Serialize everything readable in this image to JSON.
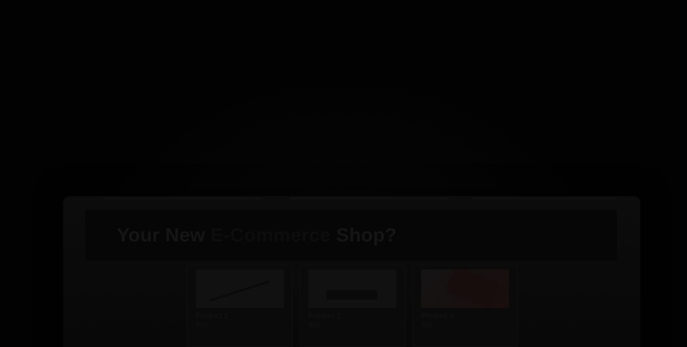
{
  "hero": {
    "headline_pre": "Your New",
    "headline_accent": "E-Commerce",
    "headline_post": "Shop?"
  },
  "products": [
    {
      "name": "Product 1",
      "price": "$99"
    },
    {
      "name": "Product 2",
      "price": "$99"
    },
    {
      "name": "Product 3",
      "price": "$99"
    }
  ],
  "colors": {
    "background": "#020202",
    "accent": "#0d0d0d"
  }
}
